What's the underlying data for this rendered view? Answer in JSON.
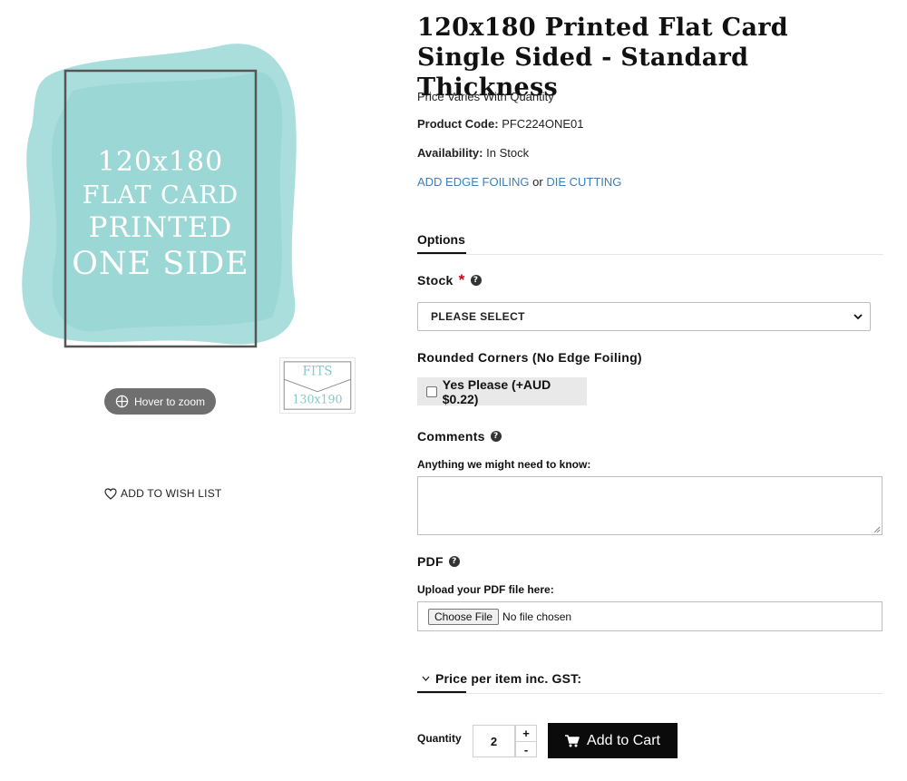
{
  "product_image": {
    "lines": [
      "120x180",
      "FLAT CARD",
      "PRINTED",
      "ONE SIDE"
    ],
    "wash_color": "#9ad8d6",
    "frame_color": "#555555"
  },
  "zoom": {
    "label": "Hover to zoom",
    "icon": "zoom-crosshair-icon"
  },
  "fits_thumb": {
    "line1": "FITS",
    "line2": "130x190",
    "color": "#86c9c6"
  },
  "wishlist": {
    "label": "ADD TO WISH LIST",
    "icon": "heart-icon"
  },
  "product": {
    "title": "120x180 Printed Flat Card Single Sided - Standard Thickness",
    "price_note": "Price Varies With Quantity",
    "code_label": "Product Code:",
    "code_value": "PFC224ONE01",
    "availability_label": "Availability:",
    "availability_value": "In Stock",
    "link_edge_foiling": "ADD EDGE FOILING",
    "link_or": "or",
    "link_die_cutting": "DIE CUTTING",
    "link_color": "#3f7fb5"
  },
  "options_tab": "Options",
  "stock": {
    "label": "Stock",
    "required_mark": "*",
    "help_icon": "?",
    "selected": "PLEASE SELECT"
  },
  "rounded_corners": {
    "label": "Rounded Corners (No Edge Foiling)",
    "checkbox_label": "Yes Please (+AUD $0.22)",
    "checked": false
  },
  "comments": {
    "label": "Comments",
    "help_icon": "?",
    "sub_label": "Anything we might need to know:",
    "value": ""
  },
  "pdf": {
    "label": "PDF",
    "help_icon": "?",
    "sub_label": "Upload your PDF file here:",
    "button": "Choose File",
    "status": "No file chosen"
  },
  "price_tab": "Price per item inc. GST:",
  "quantity": {
    "label": "Quantity",
    "value": "2",
    "plus": "+",
    "minus": "-"
  },
  "cart": {
    "label": "Add to Cart",
    "icon": "cart-icon"
  }
}
